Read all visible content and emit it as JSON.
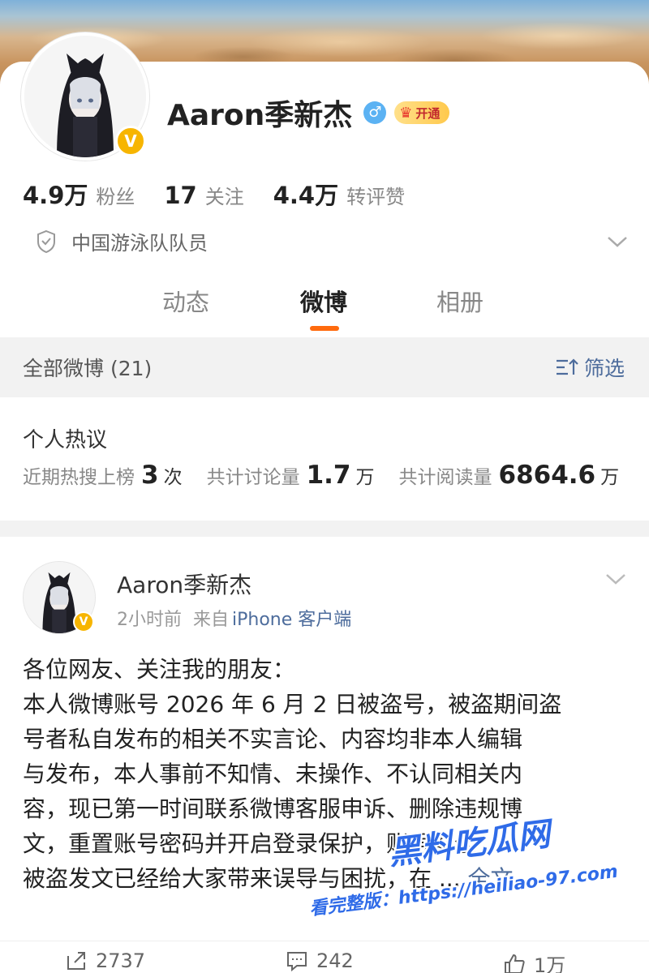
{
  "profile": {
    "name": "Aaron季新杰",
    "vip_label": "开通",
    "stats": [
      {
        "value": "4.9万",
        "label": "粉丝"
      },
      {
        "value": "17",
        "label": "关注"
      },
      {
        "value": "4.4万",
        "label": "转评赞"
      }
    ],
    "identity": "中国游泳队队员"
  },
  "tabs": [
    {
      "label": "动态"
    },
    {
      "label": "微博"
    },
    {
      "label": "相册"
    }
  ],
  "filter_bar": {
    "title": "全部微博 (21)",
    "filter_label": "筛选"
  },
  "hot": {
    "title": "个人热议",
    "items": [
      {
        "label": "近期热搜上榜",
        "value": "3",
        "unit": "次"
      },
      {
        "label": "共计讨论量",
        "value": "1.7",
        "unit": "万"
      },
      {
        "label": "共计阅读量",
        "value": "6864.6",
        "unit": "万"
      }
    ]
  },
  "post": {
    "author": "Aaron季新杰",
    "time": "2小时前",
    "source_prefix": "来自",
    "source": "iPhone 客户端",
    "lines": [
      "各位网友、关注我的朋友：",
      "本人微博账号 2026 年 6 月 2 日被盗号，被盗期间盗",
      "号者私自发布的相关不实言论、内容均非本人编辑",
      "与发布，本人事前不知情、未操作、不认同相关内",
      "容，现已第一时间联系微博客服申诉、删除违规博",
      "文，重置账号密码并开启登录保护，账号安全",
      "被盗发文已经给大家带来误导与困扰，在 ..."
    ],
    "fulltext_label": "全文",
    "reposts": "2737",
    "comments": "242",
    "likes": "1万"
  },
  "watermark": {
    "line1": "黑料吃瓜网",
    "line2": "看完整版：https://heiliao-97.com"
  }
}
